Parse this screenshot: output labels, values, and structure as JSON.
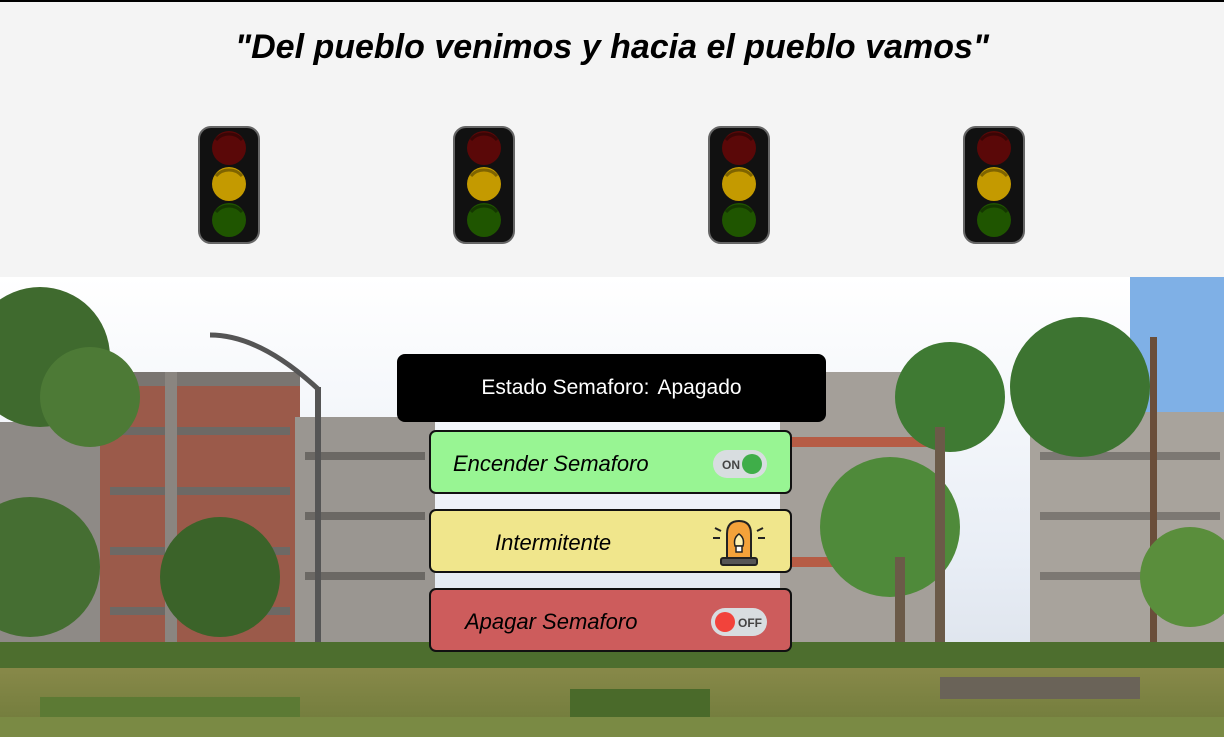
{
  "header": {
    "motto": "\"Del pueblo venimos y hacia el pueblo vamos\""
  },
  "traffic_lights": [
    {
      "id": 1,
      "red": "off",
      "yellow": "off",
      "green": "off"
    },
    {
      "id": 2,
      "red": "off",
      "yellow": "off",
      "green": "off"
    },
    {
      "id": 3,
      "red": "off",
      "yellow": "off",
      "green": "off"
    },
    {
      "id": 4,
      "red": "off",
      "yellow": "off",
      "green": "off"
    }
  ],
  "status": {
    "label": "Estado Semaforo:",
    "value": "Apagado"
  },
  "buttons": {
    "on_label": "Encender Semaforo",
    "on_icon_text": "ON",
    "on_icon": "toggle-on-icon",
    "blink_label": "Intermitente",
    "blink_icon": "siren-icon",
    "off_label": "Apagar Semaforo",
    "off_icon_text": "OFF",
    "off_icon": "toggle-off-icon"
  },
  "colors": {
    "on_button": "#98f593",
    "blink_button": "#f0e68c",
    "off_button": "#cd5c5c",
    "status_bar": "#000000",
    "light_red_off": "#6b0a0a",
    "light_yellow_off": "#c8a000",
    "light_green_off": "#1f5a00"
  }
}
